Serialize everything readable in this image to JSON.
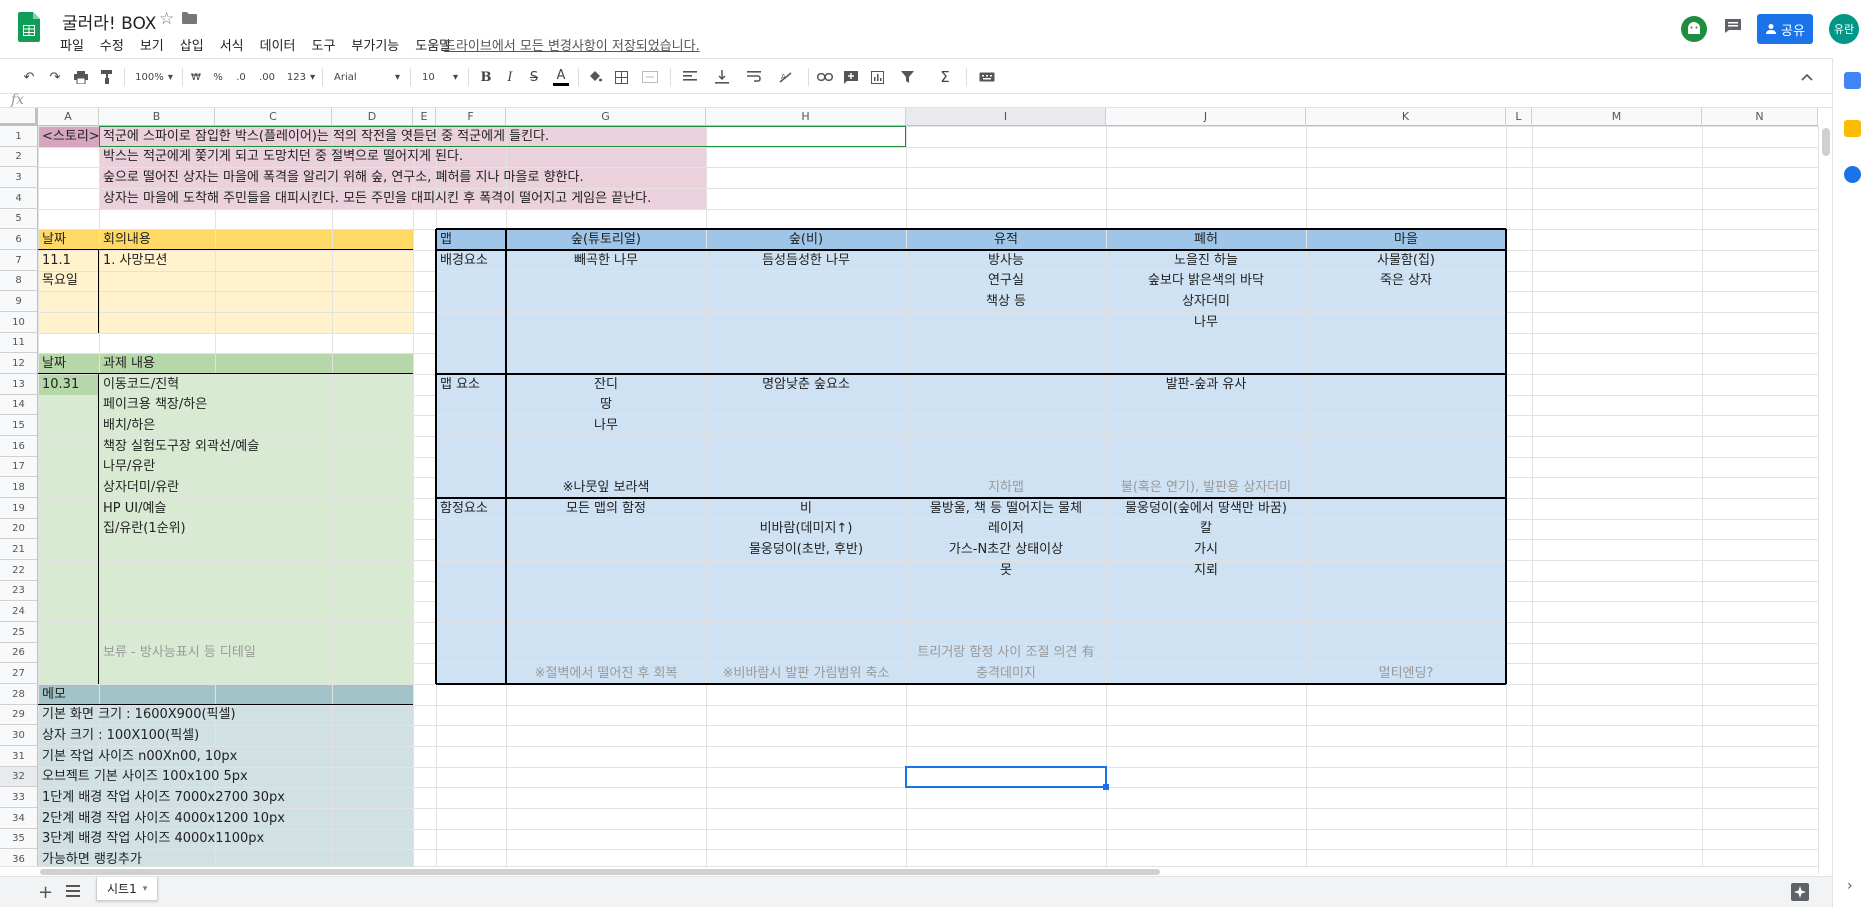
{
  "app": {
    "title": "굴러라! BOX",
    "save_status": "드라이브에서 모든 변경사항이 저장되었습니다.",
    "menus": [
      "파일",
      "수정",
      "보기",
      "삽입",
      "서식",
      "데이터",
      "도구",
      "부가기능",
      "도움말"
    ],
    "share_label": "공유",
    "avatar_label": "유란"
  },
  "toolbar": {
    "zoom": "100%",
    "currency": "₩",
    "percent": "%",
    "dec_less": ".0",
    "dec_more": ".00",
    "more_formats": "123",
    "font": "Arial",
    "font_size": "10"
  },
  "columns": [
    "A",
    "B",
    "C",
    "D",
    "E",
    "F",
    "G",
    "H",
    "I",
    "J",
    "K",
    "L",
    "M",
    "N"
  ],
  "rows": [
    "1",
    "2",
    "3",
    "4",
    "5",
    "6",
    "7",
    "8",
    "9",
    "10",
    "11",
    "12",
    "13",
    "14",
    "15",
    "16",
    "17",
    "18",
    "19",
    "20",
    "21",
    "22",
    "23",
    "24",
    "25",
    "26",
    "27",
    "28",
    "29",
    "30",
    "31",
    "32",
    "33",
    "34",
    "35",
    "36"
  ],
  "cells": {
    "A1": "<스토리>",
    "B1": "적군에 스파이로 잠입한 박스(플레이어)는 적의 작전을 엿듣던 중 적군에게 들킨다.",
    "B2": "박스는 적군에게 쫓기게 되고 도망치던 중 절벽으로 떨어지게 된다.",
    "B3": "숲으로 떨어진 상자는 마을에 폭격을 알리기 위해 숲, 연구소, 폐허를 지나 마을로 향한다.",
    "B4": "상자는 마을에 도착해 주민들을 대피시킨다. 모든 주민을 대피시킨 후 폭격이 떨어지고 게임은 끝난다.",
    "A6": "날짜",
    "B6": "회의내용",
    "A7": "11.1",
    "B7": "1. 사망모션",
    "A8": "목요일",
    "A12": "날짜",
    "B12": "과제 내용",
    "A13": "10.31",
    "B13": "이동코드/진혁",
    "B14": "페이크용 책장/하은",
    "B15": "배치/하은",
    "B16": "책장 실험도구장 외곽선/예슬",
    "B17": "나무/유란",
    "B18": "상자더미/유란",
    "B19": "HP UI/예슬",
    "B20": "집/유란(1순위)",
    "B26": "보류 -  방사능표시 등 디테일",
    "A28": "메모",
    "A29": "기본 화면 크기 : 1600X900(픽셀)",
    "A30": "상자 크기 : 100X100(픽셀)",
    "A31": "기본 작업 사이즈 n00Xn00, 10px",
    "A32": "오브젝트 기본 사이즈 100x100 5px",
    "A33": "1단계 배경 작업 사이즈 7000x2700 30px",
    "A34": "2단계 배경 작업 사이즈 4000x1200 10px",
    "A35": "3단계 배경 작업 사이즈 4000x1100px",
    "A36": "가능하면 랭킹추가",
    "F6": "맵",
    "G6": "숲(튜토리얼)",
    "H6": "숲(비)",
    "I6": "유적",
    "J6": "폐허",
    "K6": "마을",
    "F7": "배경요소",
    "G7": "빼곡한 나무",
    "H7": "듬성듬성한 나무",
    "I7": "방사능",
    "J7": "노을진 하늘",
    "K7": "사물함(집)",
    "I8": "연구실",
    "J8": "숲보다 밝은색의 바닥",
    "K8": "죽은 상자",
    "I9": "책상 등",
    "J9": "상자더미",
    "J10": "나무",
    "F13": "맵 요소",
    "G13": "잔디",
    "H13": "명암낮춘 숲요소",
    "J13": "발판-숲과 유사",
    "G14": "땅",
    "G15": "나무",
    "G18": "※나뭇잎 보라색",
    "I18": "지하맵",
    "J18": "불(혹은 연기), 발판용 상자더미",
    "F19": "함정요소",
    "G19": "모든 맵의 함정",
    "H19": "비",
    "I19": "물방울, 책 등 떨어지는 물체",
    "J19": "물웅덩이(숲에서 땅색만 바꿈)",
    "H20": "비바람(데미지↑)",
    "I20": "레이저",
    "J20": "칼",
    "H21": "물웅덩이(초반, 후반)",
    "I21": "가스-N초간 상태이상",
    "J21": "가시",
    "I22": "못",
    "J22": "지뢰",
    "I26": "트리거랑 함정 사이 조절 의견 有",
    "G27": "※절벽에서 떨어진 후 회복",
    "H27": "※비바람시 발판 가림범위 축소",
    "I27": "충격데미지",
    "K27": "멀티엔딩?"
  },
  "sheet_tab": "시트1",
  "colors": {
    "story_label": "#d5a6bd",
    "story": "#ead1dc",
    "meeting_header": "#ffd966",
    "meeting": "#fff2cc",
    "task_header": "#b6d7a8",
    "task": "#d9ead3",
    "memo_header": "#a2c4c9",
    "memo": "#d0e0e3",
    "map_header": "#9fc5e8",
    "map": "#cfe2f3",
    "accent": "#1a73e8",
    "green": "#1e8e3e"
  }
}
